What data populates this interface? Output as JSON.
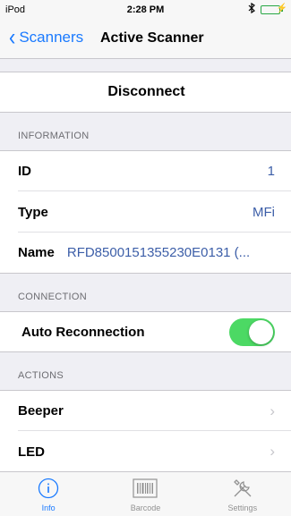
{
  "status_bar": {
    "carrier": "iPod",
    "time": "2:28 PM"
  },
  "nav": {
    "back_label": "Scanners",
    "title": "Active Scanner"
  },
  "disconnect_label": "Disconnect",
  "information": {
    "header": "INFORMATION",
    "rows": [
      {
        "label": "ID",
        "value": "1"
      },
      {
        "label": "Type",
        "value": "MFi"
      },
      {
        "label": "Name",
        "value": "RFD8500151355230E0131 (..."
      }
    ]
  },
  "connection": {
    "header": "CONNECTION",
    "auto_reconnection_label": "Auto Reconnection",
    "auto_reconnection_on": true
  },
  "actions": {
    "header": "ACTIONS",
    "items": [
      {
        "label": "Beeper"
      },
      {
        "label": "LED"
      }
    ]
  },
  "tabs": [
    {
      "label": "Info",
      "icon": "info-icon",
      "active": true
    },
    {
      "label": "Barcode",
      "icon": "barcode-icon",
      "active": false
    },
    {
      "label": "Settings",
      "icon": "settings-icon",
      "active": false
    }
  ],
  "colors": {
    "accent": "#1a7aff",
    "toggle_on": "#4cd964",
    "value_text": "#3c5ea8"
  }
}
